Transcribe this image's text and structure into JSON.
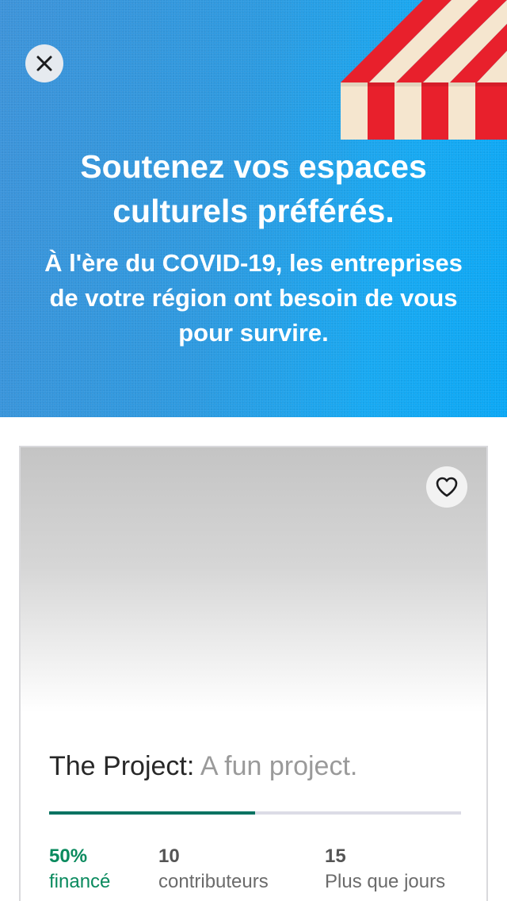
{
  "hero": {
    "title": "Soutenez vos espaces culturels préférés.",
    "subtitle": "À l'ère du COVID-19, les entreprises de votre région ont besoin de vous pour survire.",
    "close_icon": "close-icon",
    "awning_colors": {
      "red": "#e8202c",
      "cream": "#f5e6cf"
    }
  },
  "card": {
    "favorite_icon": "heart-outline-icon",
    "project_name": "The Project:",
    "project_blurb": " A fun project.",
    "progress_fraction": 0.5,
    "stats": {
      "funded_value": "50%",
      "funded_label": "financé",
      "backers_value": "10",
      "backers_label": "contributeurs",
      "days_value": "15",
      "days_label": "Plus que jours"
    }
  },
  "colors": {
    "accent_green": "#037362",
    "hero_blue": "#2d9ae0"
  }
}
